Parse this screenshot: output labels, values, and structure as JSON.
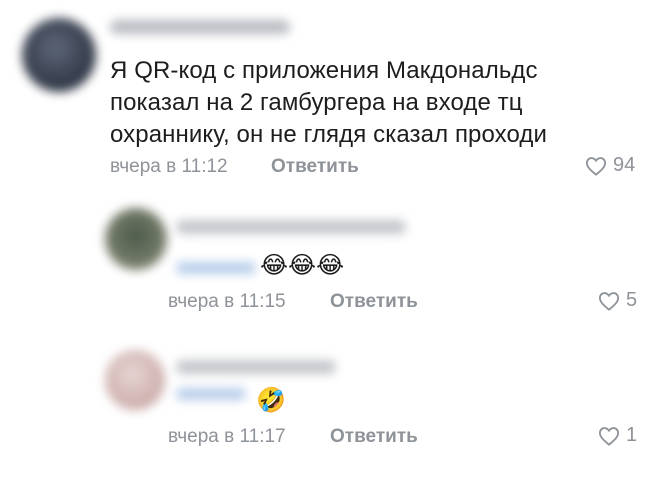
{
  "comment_main": {
    "text_lines": [
      "Я QR-код с приложения Макдональдс",
      "показал на 2 гамбургера на входе тц",
      "охраннику, он не глядя сказал проходи"
    ],
    "time": "вчера в 11:12",
    "reply_label": "Ответить",
    "likes": "94"
  },
  "reply_1": {
    "emojis": "😂😂😂",
    "time": "вчера в 11:15",
    "reply_label": "Ответить",
    "likes": "5"
  },
  "reply_2": {
    "emojis": "🤣",
    "time": "вчера в 11:17",
    "reply_label": "Ответить",
    "likes": "1"
  },
  "colors": {
    "meta": "#8e9399",
    "text": "#1d1d1f",
    "heart": "#8e9399"
  }
}
